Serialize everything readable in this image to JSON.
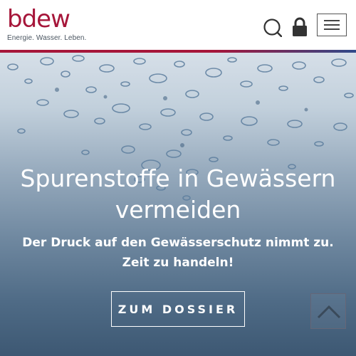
{
  "brand": {
    "name": "bdew",
    "tagline": "Energie. Wasser. Leben.",
    "primary_color": "#a6163a",
    "secondary_color": "#2f4a8a"
  },
  "header": {
    "search_icon": "search-icon",
    "login_icon": "lock-icon",
    "menu_icon": "hamburger-menu-icon"
  },
  "hero": {
    "title": "Spurenstoffe in Gewässern vermeiden",
    "subtitle": "Der Druck auf den Gewässerschutz nimmt zu. Zeit zu handeln!",
    "cta_label": "ZUM DOSSIER",
    "scroll_top_icon": "chevron-up-icon"
  }
}
